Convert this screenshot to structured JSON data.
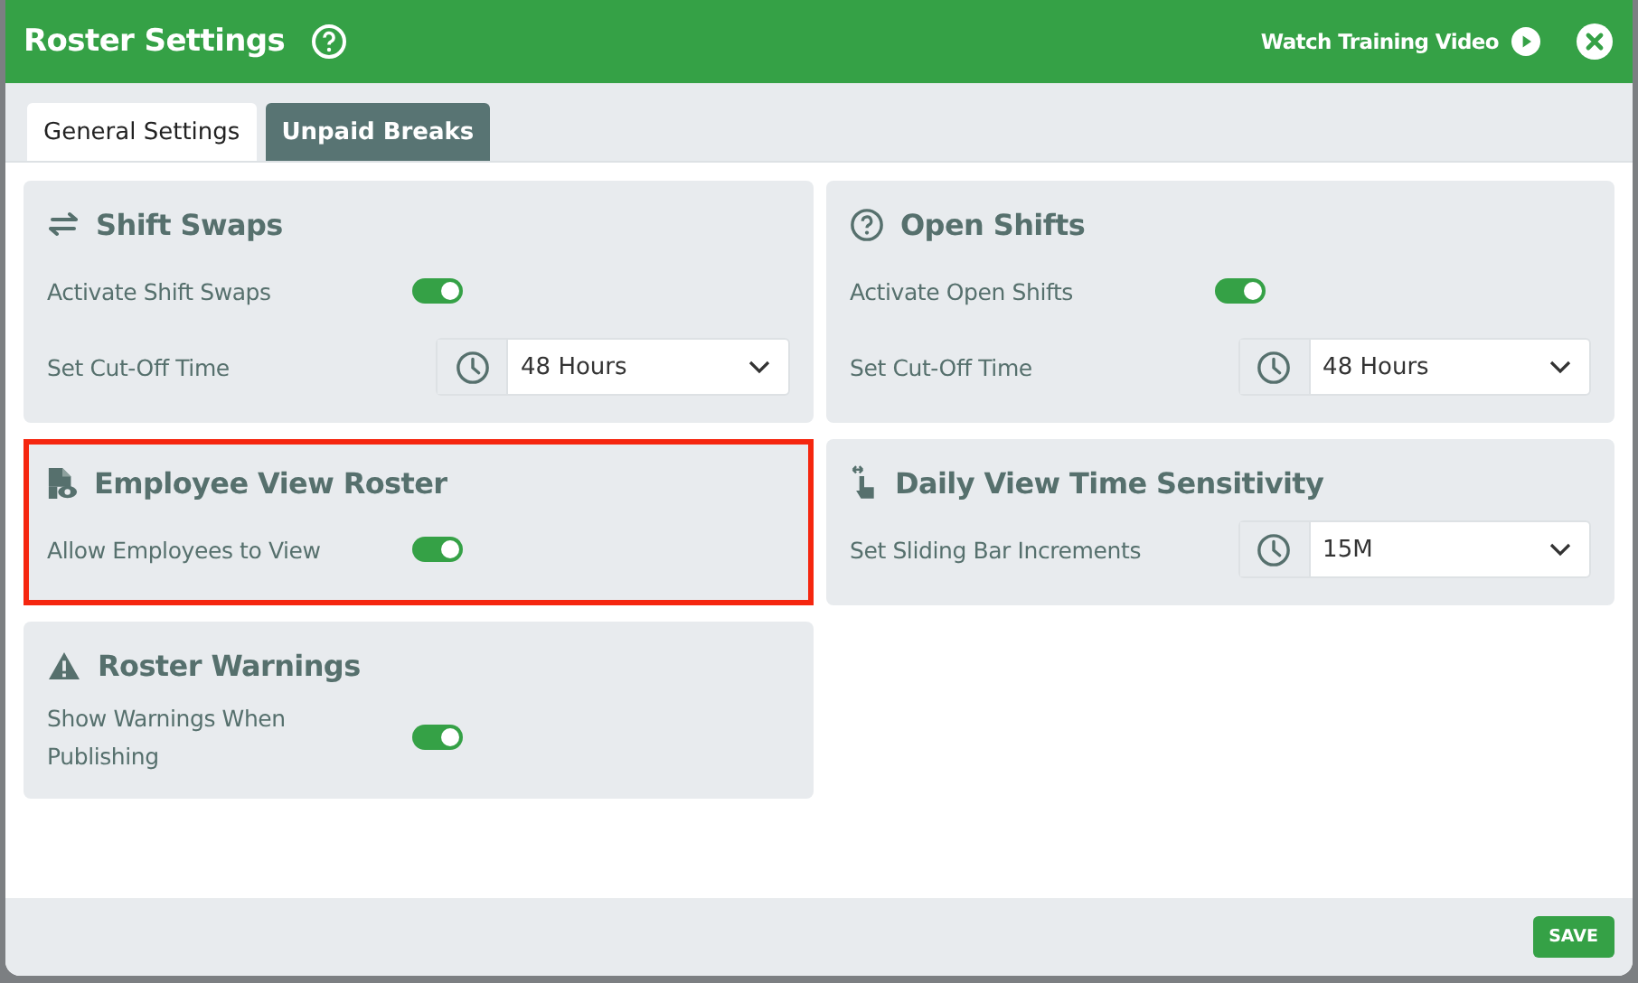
{
  "window": {
    "title": "Roster Settings",
    "training_link": "Watch Training Video"
  },
  "tabs": [
    {
      "label": "General Settings",
      "selected": true
    },
    {
      "label": "Unpaid Breaks",
      "selected": false
    }
  ],
  "columns": [
    {
      "cards": [
        {
          "title": "Shift Swaps",
          "highlighted": false,
          "rows": [
            {
              "kind": "toggle",
              "label": "Activate Shift Swaps",
              "on": true
            },
            {
              "kind": "select",
              "label": "Set Cut-Off Time",
              "value": "48 Hours"
            }
          ]
        },
        {
          "title": "Employee View Roster",
          "highlighted": true,
          "rows": [
            {
              "kind": "toggle",
              "label": "Allow Employees to View",
              "on": true
            }
          ]
        },
        {
          "title": "Roster Warnings",
          "highlighted": false,
          "rows": [
            {
              "kind": "toggle",
              "label": "Show Warnings When Publishing",
              "on": true
            }
          ]
        }
      ]
    },
    {
      "cards": [
        {
          "title": "Open Shifts",
          "highlighted": false,
          "rows": [
            {
              "kind": "toggle",
              "label": "Activate Open Shifts",
              "on": true
            },
            {
              "kind": "select",
              "label": "Set Cut-Off Time",
              "value": "48 Hours"
            }
          ]
        },
        {
          "title": "Daily View Time Sensitivity",
          "highlighted": false,
          "rows": [
            {
              "kind": "select",
              "label": "Set Sliding Bar Increments",
              "value": "15M"
            }
          ]
        }
      ]
    }
  ],
  "footer": {
    "save_button": "SAVE"
  }
}
